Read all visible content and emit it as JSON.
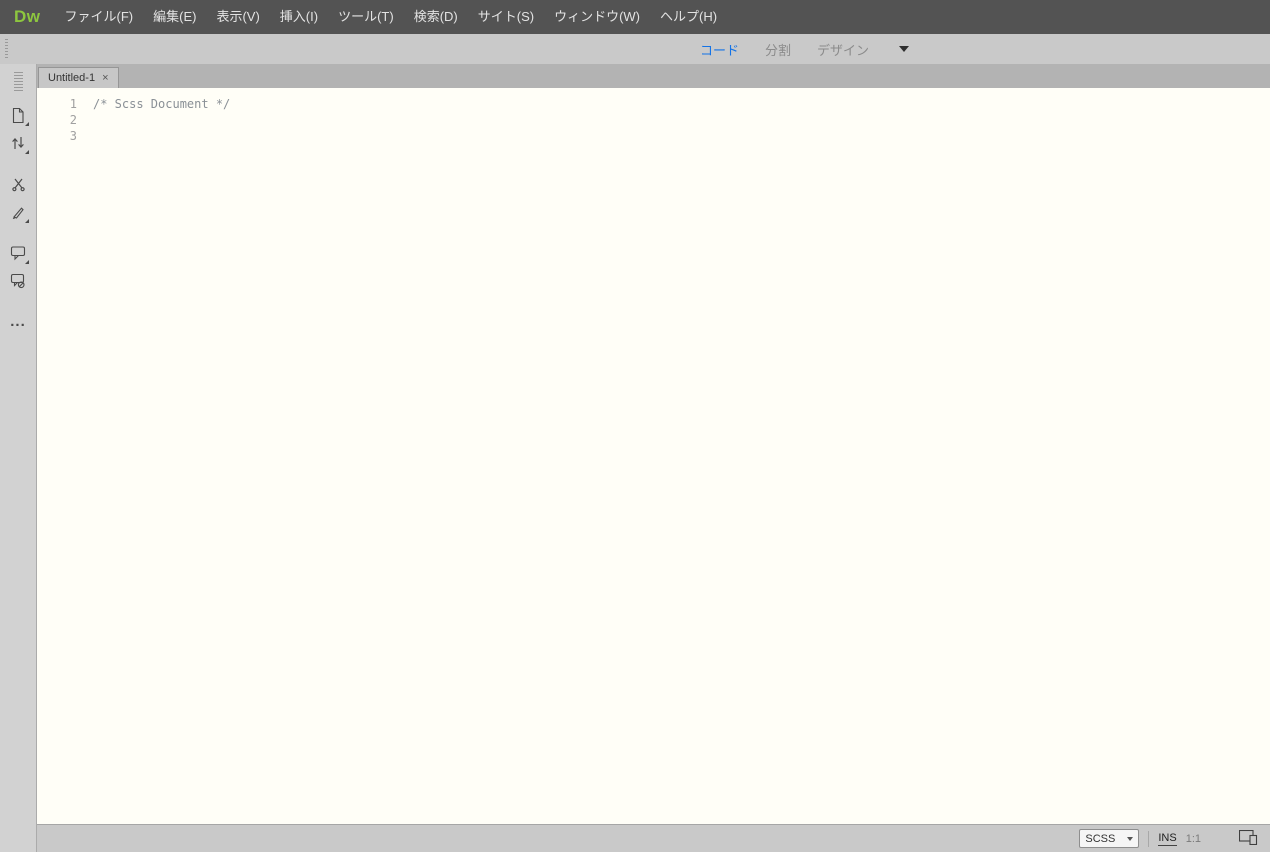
{
  "app": {
    "logo_text": "Dw"
  },
  "menubar": {
    "items": [
      {
        "label": "ファイル(F)"
      },
      {
        "label": "編集(E)"
      },
      {
        "label": "表示(V)"
      },
      {
        "label": "挿入(I)"
      },
      {
        "label": "ツール(T)"
      },
      {
        "label": "検索(D)"
      },
      {
        "label": "サイト(S)"
      },
      {
        "label": "ウィンドウ(W)"
      },
      {
        "label": "ヘルプ(H)"
      }
    ]
  },
  "view_toolbar": {
    "code_label": "コード",
    "split_label": "分割",
    "design_label": "デザイン"
  },
  "tab_bar": {
    "tabs": [
      {
        "label": "Untitled-1",
        "close_glyph": "×"
      }
    ]
  },
  "sidebar": {
    "icons": [
      {
        "name": "open-documents-icon"
      },
      {
        "name": "file-management-icon"
      },
      {
        "name": "validate-code-icon"
      },
      {
        "name": "format-source-code-icon"
      },
      {
        "name": "apply-comment-icon"
      },
      {
        "name": "remove-comment-icon"
      }
    ],
    "options_glyph": "..."
  },
  "editor": {
    "lines": [
      {
        "number": "1",
        "code": "/* Scss Document */",
        "token": "comment"
      },
      {
        "number": "2",
        "code": "",
        "token": "plain"
      },
      {
        "number": "3",
        "code": "",
        "token": "plain"
      }
    ]
  },
  "status_bar": {
    "doctype_value": "SCSS",
    "insert_mode_label": "INS",
    "cursor_position": "1:1"
  },
  "colors": {
    "menubar_bg": "#535353",
    "logo_green": "#8DC63F",
    "active_view_blue": "#1473E6",
    "editor_bg": "#FFFEF7",
    "comment_text": "#8A9096"
  }
}
